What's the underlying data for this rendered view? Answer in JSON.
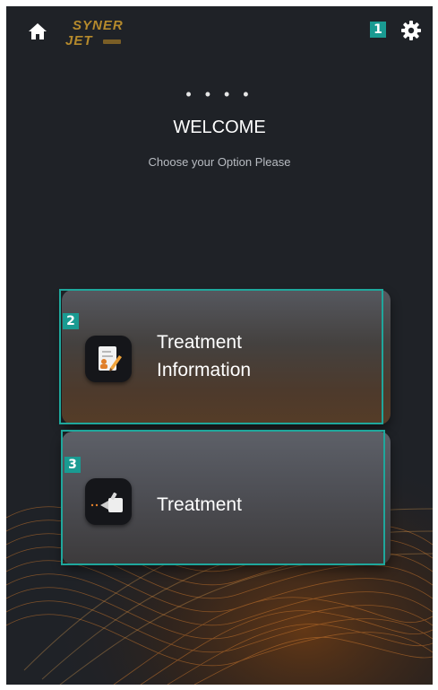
{
  "header": {
    "logo_line1": "SYNER",
    "logo_line2": "JET",
    "home_icon": "home-icon",
    "settings_icon": "gear-icon"
  },
  "main": {
    "dots": "• • • •",
    "title": "WELCOME",
    "subtitle": "Choose your Option Please"
  },
  "options": [
    {
      "label_line1": "Treatment",
      "label_line2": "Information",
      "icon": "treatment-info-icon"
    },
    {
      "label_line1": "Treatment",
      "icon": "handpiece-icon"
    }
  ],
  "annotations": [
    "1",
    "2",
    "3"
  ],
  "colors": {
    "background": "#1f2227",
    "accent": "#1a9b92",
    "logo": "#b58a2c",
    "wave": "#c8752c"
  }
}
